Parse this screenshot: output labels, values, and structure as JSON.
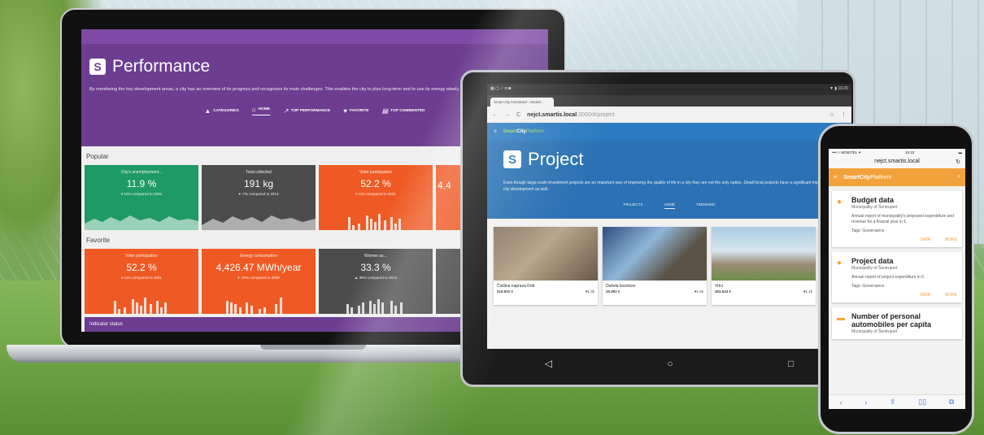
{
  "laptop": {
    "title": "Performance",
    "logo_letter": "S",
    "description": "By monitoring the key development areas, a city has an overview of its progress and recognizes its main challenges. This enables the city to plan long-term and to use its energy wisely.",
    "nav": [
      {
        "label": "CATEGORIES",
        "icon": "▲"
      },
      {
        "label": "HOME",
        "icon": "⌂"
      },
      {
        "label": "TOP PERFORMANCE",
        "icon": "↗"
      },
      {
        "label": "FAVORITE",
        "icon": "♥"
      },
      {
        "label": "TOP COMMENTED",
        "icon": "▤"
      }
    ],
    "popular_label": "Popular",
    "favorite_label": "Favorite",
    "popular": [
      {
        "label": "City's unemployment...",
        "value": "11.9 %",
        "compare": "▾ 10% compared to 2006",
        "color": "#1e9a64"
      },
      {
        "label": "Total collected",
        "value": "191 kg",
        "compare": "▾ -7% compared to 2013",
        "color": "#4c4c4c"
      },
      {
        "label": "Voter participation",
        "value": "52.2 %",
        "compare": "▾ 11% compared to 2001",
        "color": "#ef5a24"
      },
      {
        "label": "",
        "value": "4,4",
        "compare": "",
        "color": "#ef5a24"
      }
    ],
    "favorite": [
      {
        "label": "Voter participation",
        "value": "52.2 %",
        "compare": "▾ 11% compared to 2001",
        "color": "#ef5a24"
      },
      {
        "label": "Energy consumption",
        "value": "4,426.47 MWh/year",
        "compare": "▾ -20% compared to 2009",
        "color": "#ef5a24"
      },
      {
        "label": "Women as...",
        "value": "33.3 %",
        "compare": "▲ 35% compared to 2013",
        "color": "#4c4c4c"
      },
      {
        "label": "",
        "value": "",
        "compare": "",
        "color": "#4c4c4c"
      }
    ],
    "indicator_status": "Indicator status"
  },
  "tablet": {
    "status_left": "▦ ▢ ✓ ◘ ◙",
    "status_right": "▼ ▮ 10:20",
    "tab_label": "Smart city Investand - Smarti...",
    "url_bold": "nejct.smartis.local",
    "url_rest": ":3000/#/project",
    "brand_smart": "Smart",
    "brand_city": "City",
    "brand_platform": "Platform",
    "project_title": "Project",
    "project_desc": "Even though large-scale investment projects are an important way of improving the quality of life in a city they are not the only option. Small local projects have a significant impact on the city development as well.",
    "tabs": [
      "PROJECTS",
      "HOME",
      "TRENDING"
    ],
    "cards": [
      {
        "name": "Čistilna naprava Dob",
        "amount": "519.802 €",
        "likes": "♥1.3k"
      },
      {
        "name": "Dežela kozolcev",
        "amount": "26.892 €",
        "likes": "♥1.5k"
      },
      {
        "name": "Vrtci",
        "amount": "483.543 €",
        "likes": "♥1.1k"
      }
    ],
    "nav": [
      "◁",
      "○",
      "□"
    ]
  },
  "phone": {
    "carrier": "•••○○ MOBITEL ✦",
    "time": "10:23",
    "battery": "▬",
    "url": "nejct.smartis.local",
    "brand_smart": "Smart",
    "brand_city": "City",
    "brand_platform": "Platform",
    "cards": [
      {
        "title": "Budget data",
        "subtitle": "Municipality of Šentrupert",
        "description": "Annual report of municipality's proposed expenditure and revenue for a finacial year in €.",
        "tags": "Tags: Governance",
        "action_data": "DATA",
        "action_more": "MORE"
      },
      {
        "title": "Project data",
        "subtitle": "Municipality of Šentrupert",
        "description": "Annual report of project expenditure in €.",
        "tags": "Tags: Governance",
        "action_data": "DATA",
        "action_more": "MORE"
      },
      {
        "title": "Number of personal automobiles per capita",
        "subtitle": "Municipality of Šentrupert",
        "description": "",
        "tags": "",
        "action_data": "",
        "action_more": ""
      }
    ],
    "bottom_icons": [
      "‹",
      "›",
      "⇪",
      "▯▯",
      "⧉"
    ]
  },
  "colors": {
    "purple": "#6c3d91",
    "green": "#1e9a64",
    "orange": "#ef5a24",
    "dark": "#4c4c4c",
    "blue": "#2a72b3",
    "phone_orange": "#f2a23a"
  }
}
